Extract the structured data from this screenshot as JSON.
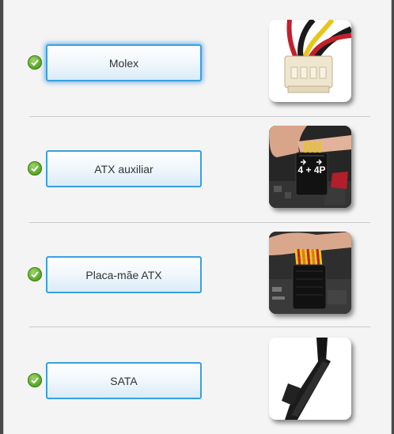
{
  "connectors": [
    {
      "label": "Molex",
      "image_icon": "molex-connector-icon"
    },
    {
      "label": "ATX auxiliar",
      "image_icon": "atx-aux-connector-icon"
    },
    {
      "label": "Placa-mãe ATX",
      "image_icon": "atx-motherboard-connector-icon"
    },
    {
      "label": "SATA",
      "image_icon": "sata-connector-icon"
    }
  ],
  "thumb_text": {
    "atx_aux": "4 + 4P"
  },
  "colors": {
    "accent": "#3aa0dd",
    "check": "#5fae2c"
  }
}
